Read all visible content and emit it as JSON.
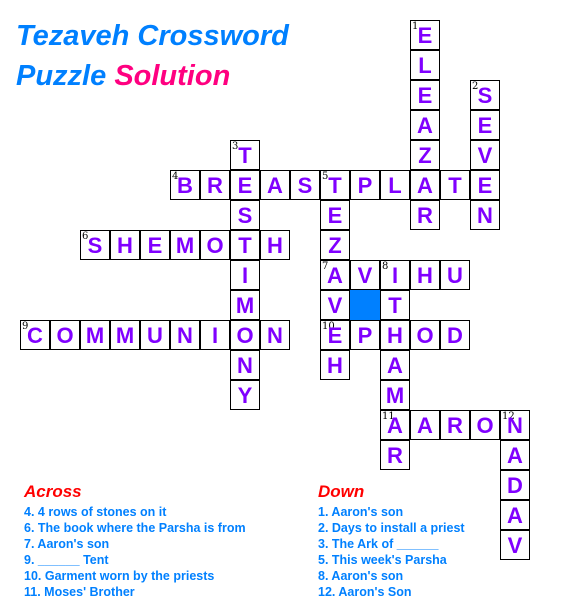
{
  "title": {
    "line1": "Tezaveh Crossword",
    "line2_part1": "Puzzle",
    "line2_part2": "Solution"
  },
  "colors": {
    "title": "#0080ff",
    "solution": "#ff0080",
    "letters": "#8000ff",
    "heading": "#ff0000",
    "clues": "#0080ff",
    "blocked": "#0080ff"
  },
  "words": [
    {
      "num": "1",
      "dir": "down",
      "answer": "ELEAZAR",
      "row": 0,
      "col": 13
    },
    {
      "num": "2",
      "dir": "down",
      "answer": "SEVEN",
      "row": 2,
      "col": 15
    },
    {
      "num": "3",
      "dir": "down",
      "answer": "TESTIMONY",
      "row": 4,
      "col": 7
    },
    {
      "num": "4",
      "dir": "across",
      "answer": "BREASTPLATE",
      "row": 5,
      "col": 5
    },
    {
      "num": "5",
      "dir": "down",
      "answer": "TEZAVEH",
      "row": 5,
      "col": 10
    },
    {
      "num": "6",
      "dir": "across",
      "answer": "SHEMOTH",
      "row": 7,
      "col": 2
    },
    {
      "num": "7",
      "dir": "across",
      "answer": "AVIHU",
      "row": 8,
      "col": 10
    },
    {
      "num": "8",
      "dir": "down",
      "answer": "ITHAMAR",
      "row": 8,
      "col": 12
    },
    {
      "num": "9",
      "dir": "across",
      "answer": "COMMUNION",
      "row": 10,
      "col": 0
    },
    {
      "num": "10",
      "dir": "across",
      "answer": "EPHOD",
      "row": 10,
      "col": 10
    },
    {
      "num": "11",
      "dir": "across",
      "answer": "AARON",
      "row": 13,
      "col": 12
    },
    {
      "num": "12",
      "dir": "down",
      "answer": "NADAV",
      "row": 13,
      "col": 16
    }
  ],
  "blocked_cells": [
    {
      "row": 9,
      "col": 11
    }
  ],
  "across": {
    "heading": "Across",
    "clues": [
      "4. 4 rows of stones on it",
      "6. The book where the Parsha is from",
      "7. Aaron's son",
      "9. ______ Tent",
      "10. Garment worn by the priests",
      "11. Moses' Brother"
    ]
  },
  "down": {
    "heading": "Down",
    "clues": [
      "1. Aaron's son",
      "2. Days to install a priest",
      "3. The Ark of ______",
      "5. This week's Parsha",
      "8. Aaron's son",
      "12. Aaron's Son"
    ]
  }
}
